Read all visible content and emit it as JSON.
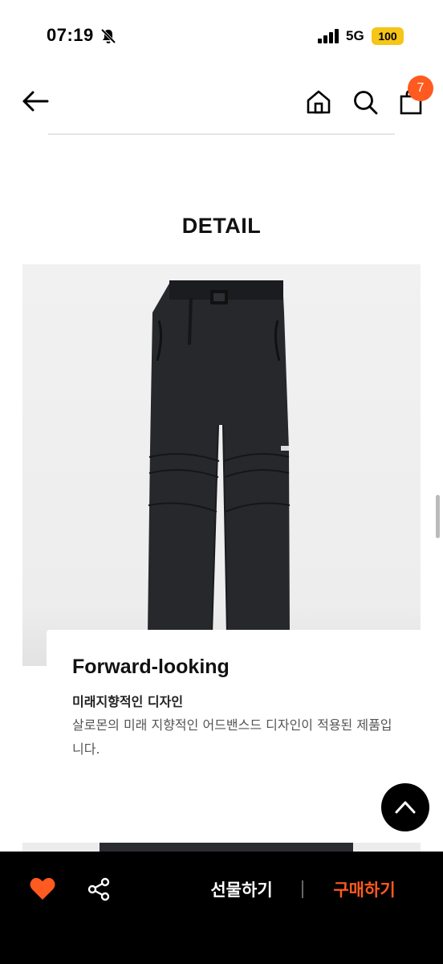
{
  "status_bar": {
    "time": "07:19",
    "network": "5G",
    "battery": "100",
    "icons": [
      "bell-off-icon",
      "signal-icon"
    ]
  },
  "header": {
    "icons": [
      "back-arrow-icon",
      "home-icon",
      "search-icon",
      "shopping-bag-icon"
    ],
    "cart_count": "7"
  },
  "detail": {
    "section_title": "DETAIL",
    "image_subject": "black cargo pants product photo",
    "card": {
      "title": "Forward-looking",
      "subtitle": "미래지향적인 디자인",
      "description": "살로몬의 미래 지향적인 어드밴스드 디자인이 적용된 제품입니다."
    }
  },
  "bottom_bar": {
    "gift_label": "선물하기",
    "buy_label": "구매하기",
    "icons": [
      "heart-icon",
      "share-icon"
    ]
  },
  "colors": {
    "accent": "#ff5a1f",
    "bar_bg": "#000000",
    "battery": "#f5c518"
  }
}
